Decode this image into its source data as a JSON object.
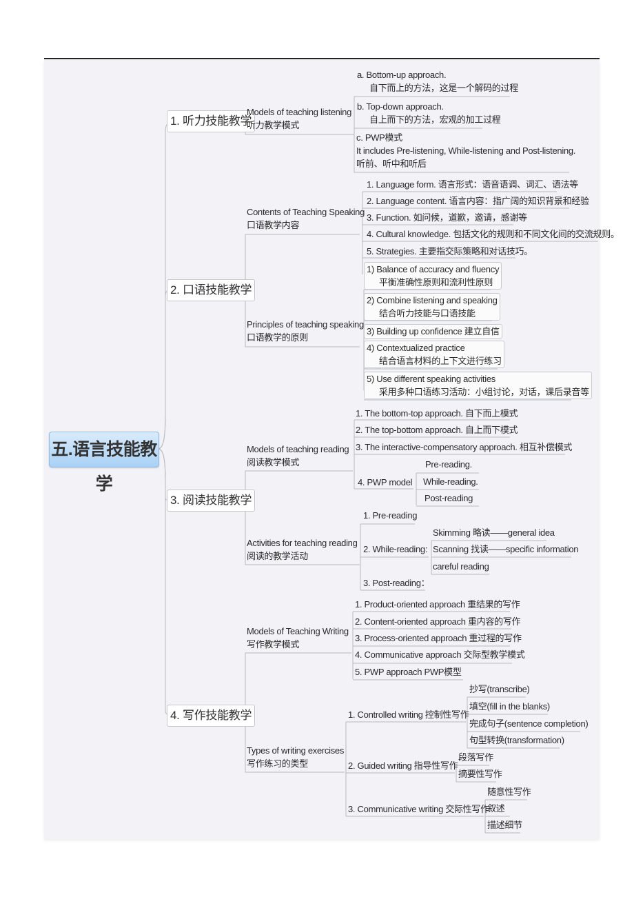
{
  "root": {
    "label": "五.语言技能教学"
  },
  "branches": [
    {
      "label": "1. 听力技能教学",
      "children": [
        {
          "en": "Models of teaching listening",
          "zh": "听力教学模式",
          "items": [
            {
              "line1": "a. Bottom-up approach.",
              "line2": "自下而上的方法，这是一个解码的过程"
            },
            {
              "line1": "b. Top-down approach.",
              "line2": "自上而下的方法，宏观的加工过程"
            },
            {
              "line1": "c. PWP模式",
              "line2": "It includes Pre-listening, While-listening and Post-listening.",
              "line3": "听前、听中和听后"
            }
          ]
        }
      ]
    },
    {
      "label": "2. 口语技能教学",
      "children": [
        {
          "en": "Contents of Teaching Speaking",
          "zh": "口语教学内容",
          "items": [
            {
              "line1": "1. Language form. 语言形式：语音语调、词汇、语法等"
            },
            {
              "line1": "2. Language content. 语言内容：指广阔的知识背景和经验"
            },
            {
              "line1": "3. Function.   如问候，道歉，邀请，感谢等"
            },
            {
              "line1": "4. Cultural knowledge.    包括文化的规则和不同文化间的交流规则。"
            },
            {
              "line1": "5. Strategies.    主要指交际策略和对话技巧。"
            }
          ]
        },
        {
          "en": "Principles of teaching speaking",
          "zh": "口语教学的原则",
          "items": [
            {
              "line1": "1) Balance of accuracy and fluency",
              "line2": "平衡准确性原则和流利性原则"
            },
            {
              "line1": "2) Combine listening and speaking",
              "line2": "结合听力技能与口语技能"
            },
            {
              "line1": "3) Building up confidence 建立自信"
            },
            {
              "line1": "4) Contextualized practice",
              "line2": "结合语言材料的上下文进行练习"
            },
            {
              "line1": "5) Use different speaking activities",
              "line2": "采用多种口语练习活动：小组讨论，对话，课后录音等"
            }
          ]
        }
      ]
    },
    {
      "label": "3. 阅读技能教学",
      "children": [
        {
          "en": "Models of teaching reading",
          "zh": "阅读教学模式",
          "items": [
            {
              "line1": "1. The bottom-top approach. 自下而上模式"
            },
            {
              "line1": "2. The top-bottom approach. 自上而下模式"
            },
            {
              "line1": "3. The interactive-compensatory approach.    相互补偿模式"
            },
            {
              "line1": "4. PWP model",
              "sub": [
                "Pre-reading.",
                "While-reading.",
                "Post-reading"
              ]
            }
          ]
        },
        {
          "en": "Activities for teaching reading",
          "zh": "阅读的教学活动",
          "items": [
            {
              "line1": "1. Pre-reading"
            },
            {
              "line1": "2. While-reading:",
              "sub": [
                "Skimming 略读——general idea",
                "Scanning 找读——specific information",
                "careful reading"
              ]
            },
            {
              "line1": "3. Post-reading："
            }
          ]
        }
      ]
    },
    {
      "label": "4. 写作技能教学",
      "children": [
        {
          "en": "Models of Teaching Writing",
          "zh": "写作教学模式",
          "items": [
            {
              "line1": "1. Product-oriented approach 重结果的写作"
            },
            {
              "line1": "2. Content-oriented approach 重内容的写作"
            },
            {
              "line1": "3. Process-oriented approach 重过程的写作"
            },
            {
              "line1": "4. Communicative approach 交际型教学模式"
            },
            {
              "line1": "5. PWP approach      PWP模型"
            }
          ]
        },
        {
          "en": "Types of writing exercises",
          "zh": "写作练习的类型",
          "items": [
            {
              "line1": "1. Controlled writing 控制性写作",
              "sub": [
                "抄写(transcribe)",
                "填空(fill in the blanks)",
                "完成句子(sentence completion)",
                "句型转换(transformation)"
              ]
            },
            {
              "line1": "2. Guided writing 指导性写作",
              "sub": [
                "段落写作",
                "摘要性写作"
              ]
            },
            {
              "line1": "3. Communicative writing 交际性写作",
              "sub": [
                "随意性写作",
                "叙述",
                "描述细节"
              ]
            }
          ]
        }
      ]
    }
  ]
}
